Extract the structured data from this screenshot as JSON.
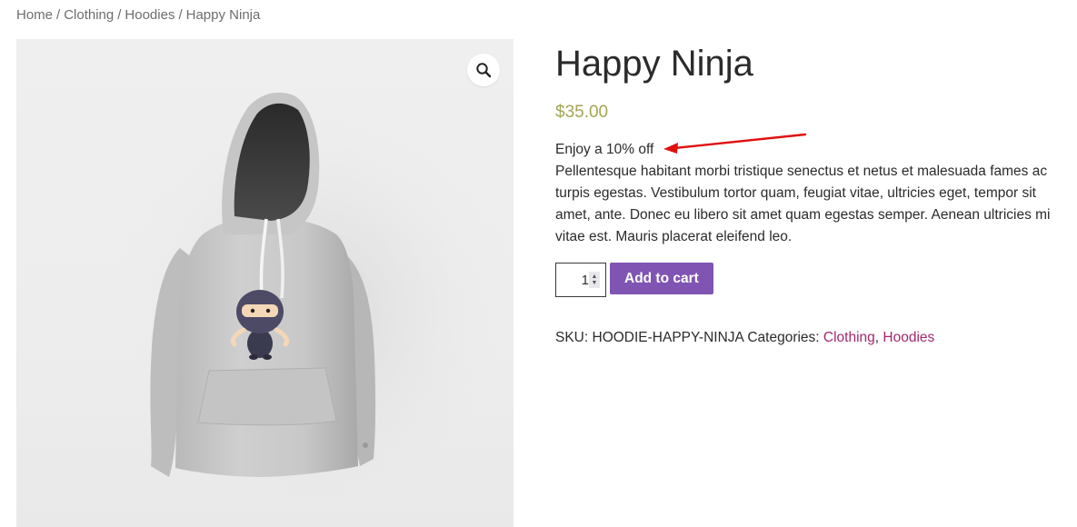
{
  "breadcrumb": {
    "items": [
      "Home",
      "Clothing",
      "Hoodies"
    ],
    "current": "Happy Ninja",
    "separator": "/"
  },
  "gallery": {
    "zoom_icon": "magnifier-icon",
    "image_alt": "Happy Ninja hoodie"
  },
  "product": {
    "title": "Happy Ninja",
    "price": "$35.00",
    "promo": "Enjoy a 10% off",
    "description": "Pellentesque habitant morbi tristique senectus et netus et malesuada fames ac turpis egestas. Vestibulum tortor quam, feugiat vitae, ultricies eget, tempor sit amet, ante. Donec eu libero sit amet quam egestas semper. Aenean ultricies mi vitae est. Mauris placerat eleifend leo.",
    "quantity": "1",
    "add_to_cart_label": "Add to cart",
    "sku_label": "SKU:",
    "sku": "HOODIE-HAPPY-NINJA",
    "categories_label": "Categories:",
    "categories": [
      "Clothing",
      "Hoodies"
    ],
    "category_separator": ","
  },
  "colors": {
    "price": "#a3a653",
    "button": "#7f54b3",
    "category_link": "#a3286d",
    "annotation_arrow": "#e01010"
  }
}
